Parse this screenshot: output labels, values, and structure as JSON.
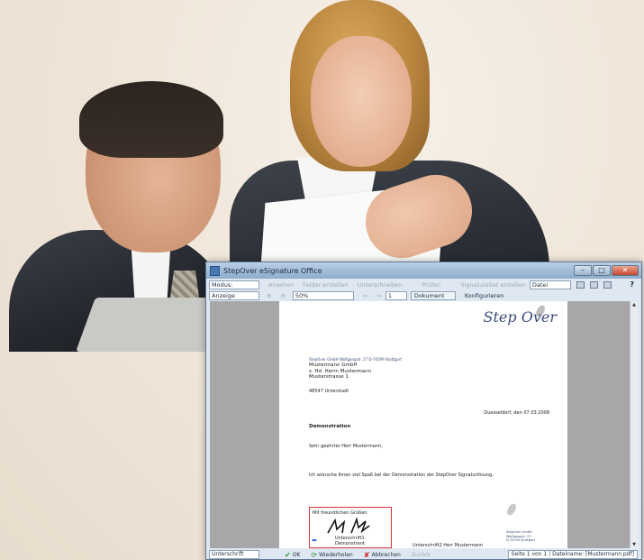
{
  "window": {
    "title": "StepOver eSignature Office",
    "ctrl_min": "–",
    "ctrl_max": "□",
    "ctrl_close": "✕"
  },
  "toolbar": {
    "mode_label": "Modus:",
    "view_label": "Anzeige",
    "row1": [
      "Ansehen",
      "Felder erstellen",
      "Unterschreiben",
      "Prüfen",
      "SignatureSet erstellen"
    ],
    "file_select": "Datei",
    "zoom_value": "50%",
    "page_value": "1",
    "document_button": "Dokument",
    "configure_button": "Konfigurieren",
    "help": "?"
  },
  "document": {
    "logo": "Step Over",
    "sender_line": "StepOver GmbH     Wolfgangstr. 27     D-70199 Stuttgart",
    "address": [
      "Mustermann GmbH",
      "z. Hd. Herrn Mustermann",
      "Musterstrasse 1"
    ],
    "zip_city": "48547 Unterstadt",
    "date": "Duesseldorf, den 07.03.2008",
    "subject": "Demonstration",
    "salutation": "Sehr geehrter Herr Mustermann,",
    "body": "ich wünsche Ihnen viel Spaß bei der Demonstration der StepOver Signaturlösung.",
    "greeting": "Mit freundlichen Grüßen",
    "signature_field_1": "Unterschrift1 Demonstrant",
    "signature_field_2": "Unterschrift2 Herr Mustermann",
    "footer_address": [
      "StepOver GmbH",
      "Wolfgangstr. 27",
      "D-70199 Stuttgart"
    ]
  },
  "statusbar": {
    "label": "Unterschrift",
    "ok": "OK",
    "repeat": "Wiederholen",
    "cancel": "Abbrechen",
    "back": "Zurück",
    "info": "Seite 1 von 1  |  Dateiname: [Mustermann.pdf]"
  },
  "colors": {
    "window_frame": "#5e7791",
    "accent": "#3a4b7a",
    "signature_box": "#dd3333",
    "ok_icon": "#2e9a2e",
    "cancel_icon": "#d02020"
  }
}
